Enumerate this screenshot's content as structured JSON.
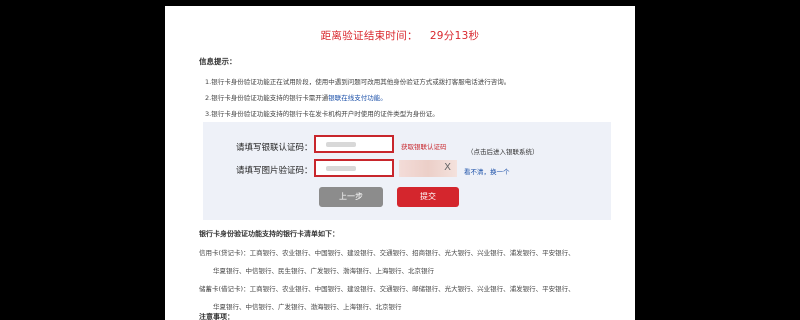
{
  "timer": {
    "label": "距离验证结束时间：",
    "value": "29分13秒"
  },
  "info": {
    "title": "信息提示：",
    "lines": [
      "1.银行卡身份验证功能正在试用阶段，使用中遇到问题可改用其他身份验证方式或拨打客服电话进行咨询。",
      "2.银行卡身份验证功能支持的银行卡需开通",
      "3.银行卡身份验证功能支持的银行卡在发卡机构开户时使用的证件类型为身份证。"
    ],
    "line2_link": "银联在线支付功能。"
  },
  "form": {
    "unionpay_label": "请填写银联认证码：",
    "get_code_label": "获取银联认证码",
    "hint": "（点击后进入银联系统）",
    "captcha_label": "请填写图片验证码：",
    "captcha_text": "X",
    "refresh_label": "看不清，换一个",
    "prev_label": "上一步",
    "submit_label": "提交"
  },
  "banks": {
    "title": "银行卡身份验证功能支持的银行卡清单如下：",
    "credit_line1": "信用卡(贷记卡)：工商银行、农业银行、中国银行、建设银行、交通银行、招商银行、光大银行、兴业银行、浦发银行、平安银行、",
    "credit_line2": "华夏银行、中信银行、民生银行、广发银行、渤海银行、上海银行、北京银行",
    "debit_line1": "储蓄卡(借记卡)：工商银行、农业银行、中国银行、建设银行、交通银行、邮储银行、光大银行、兴业银行、浦发银行、平安银行、",
    "debit_line2": "华夏银行、中信银行、广发银行、渤海银行、上海银行、北京银行",
    "notes_title": "注意事项："
  }
}
